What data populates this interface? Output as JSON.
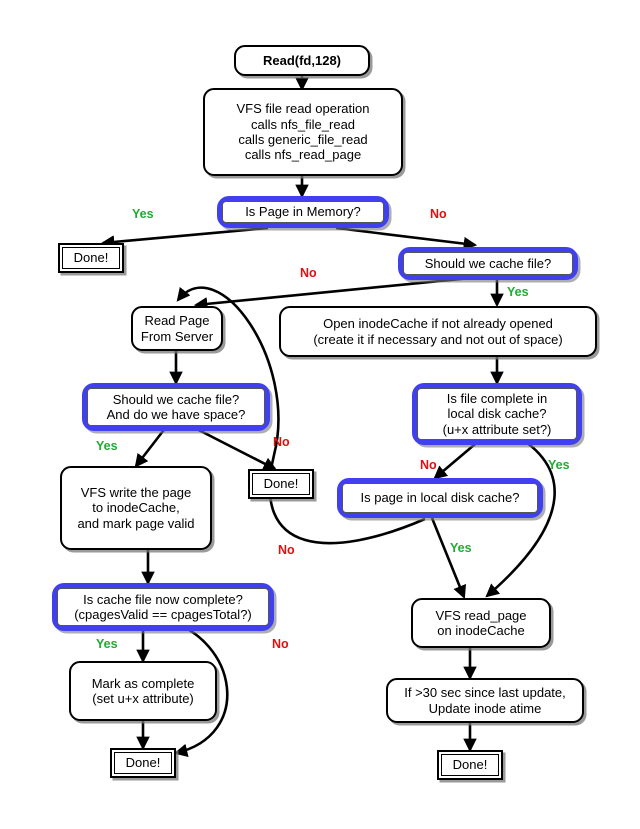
{
  "diagram": {
    "title": "NFS cached read flowchart",
    "colors": {
      "decision_border": "#4040f0",
      "yes_label": "#22aa33",
      "no_label": "#dd1111",
      "node_border": "#000000",
      "background": "#ffffff"
    },
    "nodes": [
      {
        "id": "start",
        "type": "terminal",
        "text": "Read(fd,128)"
      },
      {
        "id": "vfs_read",
        "type": "process",
        "text": "VFS file read operation\n calls nfs_file_read\n calls generic_file_read\n calls nfs_read_page"
      },
      {
        "id": "page_in_mem",
        "type": "decision",
        "text": "Is Page in Memory?"
      },
      {
        "id": "done1",
        "type": "terminal_end",
        "text": "Done!"
      },
      {
        "id": "cache_file",
        "type": "decision",
        "text": "Should we cache file?"
      },
      {
        "id": "read_page",
        "type": "process",
        "text": "Read Page\nFrom Server"
      },
      {
        "id": "open_inode",
        "type": "process",
        "text": "Open inodeCache if not already opened\n(create it if necessary and not out of space)"
      },
      {
        "id": "cache_space",
        "type": "decision",
        "text": "Should we cache file?\nAnd do we have space?"
      },
      {
        "id": "file_complete",
        "type": "decision",
        "text": "Is file complete in\nlocal disk cache?\n(u+x attribute set?)"
      },
      {
        "id": "done2",
        "type": "terminal_end",
        "text": "Done!"
      },
      {
        "id": "vfs_write",
        "type": "process",
        "text": "VFS write the page\nto inodeCache,\nand mark page valid"
      },
      {
        "id": "page_in_disk",
        "type": "decision",
        "text": "Is page in local disk cache?"
      },
      {
        "id": "cache_now",
        "type": "decision",
        "text": "Is cache file now complete?\n(cpagesValid == cpagesTotal?)"
      },
      {
        "id": "vfs_readpage",
        "type": "process",
        "text": "VFS read_page\non inodeCache"
      },
      {
        "id": "mark_complete",
        "type": "process",
        "text": "Mark as complete\n(set u+x attribute)"
      },
      {
        "id": "update_atime",
        "type": "process",
        "text": "If >30 sec since last update,\nUpdate inode atime"
      },
      {
        "id": "done3",
        "type": "terminal_end",
        "text": "Done!"
      },
      {
        "id": "done4",
        "type": "terminal_end",
        "text": "Done!"
      }
    ],
    "edge_labels": [
      {
        "id": "l1",
        "text": "Yes",
        "kind": "yes",
        "from": "page_in_mem",
        "to": "done1"
      },
      {
        "id": "l2",
        "text": "No",
        "kind": "no",
        "from": "page_in_mem",
        "to": "cache_file"
      },
      {
        "id": "l3",
        "text": "No",
        "kind": "no",
        "from": "cache_file",
        "to": "read_page"
      },
      {
        "id": "l4",
        "text": "Yes",
        "kind": "yes",
        "from": "cache_file",
        "to": "open_inode"
      },
      {
        "id": "l5",
        "text": "Yes",
        "kind": "yes",
        "from": "cache_space",
        "to": "vfs_write"
      },
      {
        "id": "l6",
        "text": "No",
        "kind": "no",
        "from": "cache_space",
        "to": "done2"
      },
      {
        "id": "l7",
        "text": "No",
        "kind": "no",
        "from": "file_complete",
        "to": "page_in_disk"
      },
      {
        "id": "l8",
        "text": "Yes",
        "kind": "yes",
        "from": "file_complete",
        "to": "vfs_readpage"
      },
      {
        "id": "l9",
        "text": "No",
        "kind": "no",
        "from": "page_in_disk",
        "to": "read_page"
      },
      {
        "id": "l10",
        "text": "Yes",
        "kind": "yes",
        "from": "page_in_disk",
        "to": "vfs_readpage"
      },
      {
        "id": "l11",
        "text": "Yes",
        "kind": "yes",
        "from": "cache_now",
        "to": "mark_complete"
      },
      {
        "id": "l12",
        "text": "No",
        "kind": "no",
        "from": "cache_now",
        "to": "done3"
      }
    ]
  }
}
